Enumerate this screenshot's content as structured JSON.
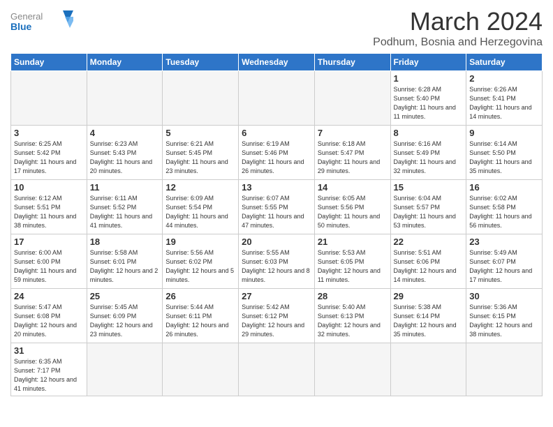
{
  "header": {
    "logo_general": "General",
    "logo_blue": "Blue",
    "month_year": "March 2024",
    "location": "Podhum, Bosnia and Herzegovina"
  },
  "weekdays": [
    "Sunday",
    "Monday",
    "Tuesday",
    "Wednesday",
    "Thursday",
    "Friday",
    "Saturday"
  ],
  "weeks": [
    [
      {
        "day": "",
        "info": ""
      },
      {
        "day": "",
        "info": ""
      },
      {
        "day": "",
        "info": ""
      },
      {
        "day": "",
        "info": ""
      },
      {
        "day": "",
        "info": ""
      },
      {
        "day": "1",
        "info": "Sunrise: 6:28 AM\nSunset: 5:40 PM\nDaylight: 11 hours and 11 minutes."
      },
      {
        "day": "2",
        "info": "Sunrise: 6:26 AM\nSunset: 5:41 PM\nDaylight: 11 hours and 14 minutes."
      }
    ],
    [
      {
        "day": "3",
        "info": "Sunrise: 6:25 AM\nSunset: 5:42 PM\nDaylight: 11 hours and 17 minutes."
      },
      {
        "day": "4",
        "info": "Sunrise: 6:23 AM\nSunset: 5:43 PM\nDaylight: 11 hours and 20 minutes."
      },
      {
        "day": "5",
        "info": "Sunrise: 6:21 AM\nSunset: 5:45 PM\nDaylight: 11 hours and 23 minutes."
      },
      {
        "day": "6",
        "info": "Sunrise: 6:19 AM\nSunset: 5:46 PM\nDaylight: 11 hours and 26 minutes."
      },
      {
        "day": "7",
        "info": "Sunrise: 6:18 AM\nSunset: 5:47 PM\nDaylight: 11 hours and 29 minutes."
      },
      {
        "day": "8",
        "info": "Sunrise: 6:16 AM\nSunset: 5:49 PM\nDaylight: 11 hours and 32 minutes."
      },
      {
        "day": "9",
        "info": "Sunrise: 6:14 AM\nSunset: 5:50 PM\nDaylight: 11 hours and 35 minutes."
      }
    ],
    [
      {
        "day": "10",
        "info": "Sunrise: 6:12 AM\nSunset: 5:51 PM\nDaylight: 11 hours and 38 minutes."
      },
      {
        "day": "11",
        "info": "Sunrise: 6:11 AM\nSunset: 5:52 PM\nDaylight: 11 hours and 41 minutes."
      },
      {
        "day": "12",
        "info": "Sunrise: 6:09 AM\nSunset: 5:54 PM\nDaylight: 11 hours and 44 minutes."
      },
      {
        "day": "13",
        "info": "Sunrise: 6:07 AM\nSunset: 5:55 PM\nDaylight: 11 hours and 47 minutes."
      },
      {
        "day": "14",
        "info": "Sunrise: 6:05 AM\nSunset: 5:56 PM\nDaylight: 11 hours and 50 minutes."
      },
      {
        "day": "15",
        "info": "Sunrise: 6:04 AM\nSunset: 5:57 PM\nDaylight: 11 hours and 53 minutes."
      },
      {
        "day": "16",
        "info": "Sunrise: 6:02 AM\nSunset: 5:58 PM\nDaylight: 11 hours and 56 minutes."
      }
    ],
    [
      {
        "day": "17",
        "info": "Sunrise: 6:00 AM\nSunset: 6:00 PM\nDaylight: 11 hours and 59 minutes."
      },
      {
        "day": "18",
        "info": "Sunrise: 5:58 AM\nSunset: 6:01 PM\nDaylight: 12 hours and 2 minutes."
      },
      {
        "day": "19",
        "info": "Sunrise: 5:56 AM\nSunset: 6:02 PM\nDaylight: 12 hours and 5 minutes."
      },
      {
        "day": "20",
        "info": "Sunrise: 5:55 AM\nSunset: 6:03 PM\nDaylight: 12 hours and 8 minutes."
      },
      {
        "day": "21",
        "info": "Sunrise: 5:53 AM\nSunset: 6:05 PM\nDaylight: 12 hours and 11 minutes."
      },
      {
        "day": "22",
        "info": "Sunrise: 5:51 AM\nSunset: 6:06 PM\nDaylight: 12 hours and 14 minutes."
      },
      {
        "day": "23",
        "info": "Sunrise: 5:49 AM\nSunset: 6:07 PM\nDaylight: 12 hours and 17 minutes."
      }
    ],
    [
      {
        "day": "24",
        "info": "Sunrise: 5:47 AM\nSunset: 6:08 PM\nDaylight: 12 hours and 20 minutes."
      },
      {
        "day": "25",
        "info": "Sunrise: 5:45 AM\nSunset: 6:09 PM\nDaylight: 12 hours and 23 minutes."
      },
      {
        "day": "26",
        "info": "Sunrise: 5:44 AM\nSunset: 6:11 PM\nDaylight: 12 hours and 26 minutes."
      },
      {
        "day": "27",
        "info": "Sunrise: 5:42 AM\nSunset: 6:12 PM\nDaylight: 12 hours and 29 minutes."
      },
      {
        "day": "28",
        "info": "Sunrise: 5:40 AM\nSunset: 6:13 PM\nDaylight: 12 hours and 32 minutes."
      },
      {
        "day": "29",
        "info": "Sunrise: 5:38 AM\nSunset: 6:14 PM\nDaylight: 12 hours and 35 minutes."
      },
      {
        "day": "30",
        "info": "Sunrise: 5:36 AM\nSunset: 6:15 PM\nDaylight: 12 hours and 38 minutes."
      }
    ],
    [
      {
        "day": "31",
        "info": "Sunrise: 6:35 AM\nSunset: 7:17 PM\nDaylight: 12 hours and 41 minutes."
      },
      {
        "day": "",
        "info": ""
      },
      {
        "day": "",
        "info": ""
      },
      {
        "day": "",
        "info": ""
      },
      {
        "day": "",
        "info": ""
      },
      {
        "day": "",
        "info": ""
      },
      {
        "day": "",
        "info": ""
      }
    ]
  ]
}
